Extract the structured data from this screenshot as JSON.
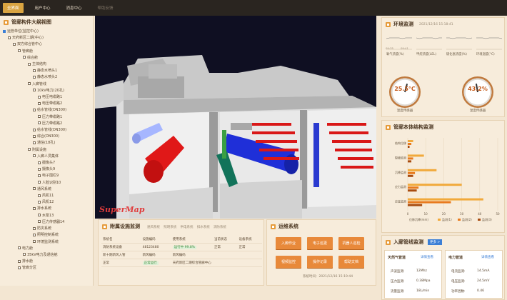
{
  "nav": {
    "items": [
      "全界面",
      "用户中心",
      "消息中心",
      "帮助反馈"
    ]
  },
  "left_panel": {
    "title": "管廊构件大纲视图",
    "tree": [
      {
        "label": "运管单位(监控中心)",
        "indent": 0,
        "checked": true
      },
      {
        "label": "天府新区二期(中心)",
        "indent": 1
      },
      {
        "label": "双方综合管中心",
        "indent": 2
      },
      {
        "label": "管廊舱",
        "indent": 3
      },
      {
        "label": "综合舱",
        "indent": 4
      },
      {
        "label": "主体结构",
        "indent": 5
      },
      {
        "label": "静态水喷头1",
        "indent": 6
      },
      {
        "label": "静态水喷头2",
        "indent": 6
      },
      {
        "label": "入廊管线",
        "indent": 5
      },
      {
        "label": "10kV电力(20孔)",
        "indent": 6
      },
      {
        "label": "电压电缆路1",
        "indent": 7
      },
      {
        "label": "电压带缆路2",
        "indent": 7
      },
      {
        "label": "给水管线(DN300)",
        "indent": 6
      },
      {
        "label": "压力带缆路1",
        "indent": 7
      },
      {
        "label": "压力带缆路2",
        "indent": 7
      },
      {
        "label": "给水管线(DN300)",
        "indent": 6
      },
      {
        "label": "综合(DN300)",
        "indent": 6
      },
      {
        "label": "通信(18孔)",
        "indent": 6
      },
      {
        "label": "附属设施",
        "indent": 5
      },
      {
        "label": "入廊人员集体",
        "indent": 6
      },
      {
        "label": "摄像头7",
        "indent": 7
      },
      {
        "label": "摄像头9",
        "indent": 7
      },
      {
        "label": "电子围栏9",
        "indent": 7
      },
      {
        "label": "人脸识别10",
        "indent": 7
      },
      {
        "label": "通风系统",
        "indent": 6
      },
      {
        "label": "风机11",
        "indent": 7
      },
      {
        "label": "风机12",
        "indent": 7
      },
      {
        "label": "排水系统",
        "indent": 6
      },
      {
        "label": "水泵13",
        "indent": 7
      },
      {
        "label": "压力传感器14",
        "indent": 7
      },
      {
        "label": "防灾系统",
        "indent": 6
      },
      {
        "label": "照明控制系统",
        "indent": 6
      },
      {
        "label": "环境监测系统",
        "indent": 6
      },
      {
        "label": "电力舱",
        "indent": 3
      },
      {
        "label": "35kV电力及通信舱",
        "indent": 4
      },
      {
        "label": "排水舱",
        "indent": 3
      },
      {
        "label": "管廊分区",
        "indent": 3
      }
    ]
  },
  "scene": {
    "watermark": "SuperMap"
  },
  "env": {
    "title": "环境监测",
    "timestamp": "2021/12/16 15:18:41",
    "sparks": [
      {
        "label": "氧气浓度(%)",
        "t0": "09:35",
        "t1": "09:41"
      },
      {
        "label": "甲烷浓度(LEL)",
        "t0": "",
        "t1": ""
      },
      {
        "label": "硫化氢浓度(%)",
        "t0": "",
        "t1": ""
      },
      {
        "label": "环境温度(°C)",
        "t0": "",
        "t1": ""
      }
    ],
    "gauges": [
      {
        "value": "25.5°C",
        "label": "温度传感器",
        "level": 0.55
      },
      {
        "value": "43.2%",
        "label": "湿度传感器",
        "level": 0.43
      }
    ]
  },
  "structure": {
    "title": "管廊本体结构监测",
    "legend": [
      "监测(1)",
      "监测(2)",
      "监测(3)"
    ],
    "xlabel": "位移沉降(mm)",
    "colors": [
      "#f1a93b",
      "#e87b1e",
      "#a84c10"
    ]
  },
  "chart_data": {
    "type": "bar",
    "orientation": "horizontal",
    "categories": [
      "结构位移",
      "裂缝监测",
      "沉降监测",
      "应力监测",
      "应变监测"
    ],
    "series": [
      {
        "name": "监测(1)",
        "values": [
          3,
          9,
          16,
          30,
          42
        ]
      },
      {
        "name": "监测(2)",
        "values": [
          2,
          3,
          4,
          6,
          24
        ]
      },
      {
        "name": "监测(3)",
        "values": [
          1,
          2,
          3,
          5,
          8
        ]
      }
    ],
    "xlim": [
      0,
      50
    ],
    "ticks": [
      "0",
      "10",
      "20",
      "30",
      "40",
      "50"
    ],
    "xlabel": "位移沉降(mm)"
  },
  "facility": {
    "title": "附属设施监测",
    "tabs": [
      "通风系统",
      "照明系统",
      "供电系统",
      "排水系统",
      "消防系统"
    ],
    "rows": [
      [
        "系统名",
        "设施编码",
        "使用系统",
        "当前状态",
        "设备系统"
      ],
      [
        "消防系统设备",
        "48123480",
        "运行中 99.8%",
        "正常",
        "正常"
      ],
      [
        "新十期新风入管",
        "新风编码",
        "新风编码",
        ""
      ],
      [
        "正常",
        "正常运行",
        "天府新区二期综合管廊中心"
      ]
    ]
  },
  "ops": {
    "title": "运维系统",
    "buttons": [
      "入廊作业",
      "电子巡更",
      "机器人巡检",
      "视频监控",
      "操作记录",
      "帮助文档"
    ],
    "timestamp": "系统时间：2021/12/16 15:19:44"
  },
  "pipes": {
    "title": "入廊管线监测",
    "more": "更多 >",
    "cards": [
      {
        "title": "天然气管道",
        "link": "详情查看",
        "rows": [
          [
            "声波监测:",
            "12Mhz"
          ],
          [
            "压力监测:",
            "0.38Mpa"
          ],
          [
            "流量监测:",
            "18L/min"
          ]
        ]
      },
      {
        "title": "电力管道",
        "link": "详情查看",
        "rows": [
          [
            "电流监测:",
            "14.5mA"
          ],
          [
            "电压监测:",
            "24.5mV"
          ],
          [
            "功率因数:",
            "0.46"
          ]
        ]
      }
    ]
  }
}
